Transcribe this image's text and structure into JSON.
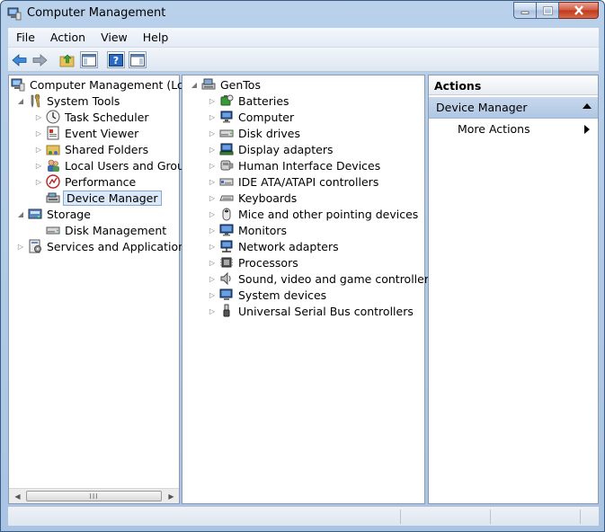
{
  "window": {
    "title": "Computer Management"
  },
  "menu": {
    "file": "File",
    "action": "Action",
    "view": "View",
    "help": "Help"
  },
  "left_tree": {
    "root": "Computer Management (Local",
    "system_tools": "System Tools",
    "task_scheduler": "Task Scheduler",
    "event_viewer": "Event Viewer",
    "shared_folders": "Shared Folders",
    "local_users": "Local Users and Groups",
    "performance": "Performance",
    "device_manager": "Device Manager",
    "storage": "Storage",
    "disk_management": "Disk Management",
    "services": "Services and Applications"
  },
  "devices": {
    "root": "GenTos",
    "items": [
      {
        "label": "Batteries",
        "icon": "battery-icon"
      },
      {
        "label": "Computer",
        "icon": "computer-icon"
      },
      {
        "label": "Disk drives",
        "icon": "disk-drive-icon"
      },
      {
        "label": "Display adapters",
        "icon": "display-adapter-icon"
      },
      {
        "label": "Human Interface Devices",
        "icon": "hid-icon"
      },
      {
        "label": "IDE ATA/ATAPI controllers",
        "icon": "ide-controller-icon"
      },
      {
        "label": "Keyboards",
        "icon": "keyboard-icon"
      },
      {
        "label": "Mice and other pointing devices",
        "icon": "mouse-icon"
      },
      {
        "label": "Monitors",
        "icon": "monitor-icon"
      },
      {
        "label": "Network adapters",
        "icon": "network-adapter-icon"
      },
      {
        "label": "Processors",
        "icon": "processor-icon"
      },
      {
        "label": "Sound, video and game controllers",
        "icon": "speaker-icon"
      },
      {
        "label": "System devices",
        "icon": "system-devices-icon"
      },
      {
        "label": "Universal Serial Bus controllers",
        "icon": "usb-icon"
      }
    ]
  },
  "actions": {
    "header": "Actions",
    "group": "Device Manager",
    "more_actions": "More Actions"
  },
  "scrollbar": {
    "grip": "III"
  },
  "colors": {
    "selection_bg": "#dbe8f7",
    "selection_border": "#85a9d6",
    "frame": "#b9d1ea"
  }
}
